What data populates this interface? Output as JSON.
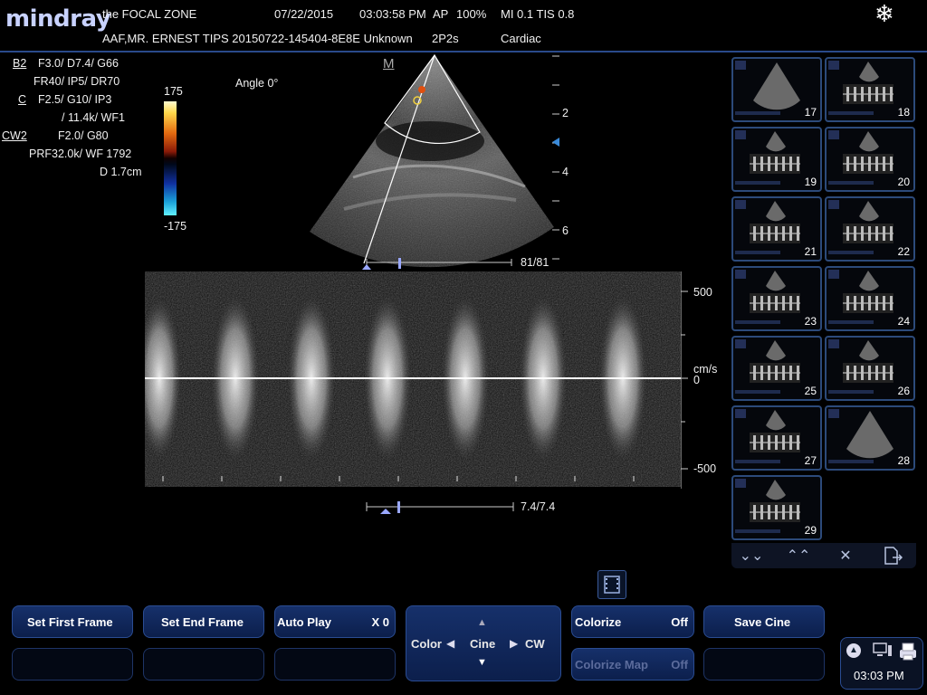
{
  "header": {
    "logo": "mindray",
    "zone": "the FOCAL ZONE",
    "date": "07/22/2015",
    "time": "03:03:58 PM",
    "ap_label": "AP",
    "ap_value": "100%",
    "mi_tis": "MI 0.1 TIS 0.8",
    "patient": "AAF,MR. ERNEST TIPS 20150722-145404-8E8E Unknown",
    "probe": "2P2s",
    "exam": "Cardiac",
    "freeze_icon": "snowflake-icon"
  },
  "params": {
    "b2_label": "B2",
    "b2_line1": "F3.0/ D7.4/ G66",
    "b2_line2": "FR40/ IP5/ DR70",
    "c_label": "C",
    "c_line1": "F2.5/ G10/ IP3",
    "c_line2": "/ 11.4k/ WF1",
    "cw_label": "CW2",
    "cw_line1": "F2.0/ G80",
    "cw_line2": "PRF32.0k/ WF 1792",
    "cw_line3": "D 1.7cm"
  },
  "colorbar": {
    "max": "175",
    "min": "-175"
  },
  "image": {
    "angle": "Angle 0°",
    "m_marker": "M",
    "depth_ticks": [
      "2",
      "4",
      "6"
    ],
    "frame_counter": "81/81",
    "cine_counter": "7.4/7.4"
  },
  "doppler": {
    "scale_top": "500",
    "scale_unit": "cm/s",
    "scale_zero": "0",
    "scale_bottom": "-500"
  },
  "thumbnails": [
    "17",
    "18",
    "19",
    "20",
    "21",
    "22",
    "23",
    "24",
    "25",
    "26",
    "27",
    "28",
    "29"
  ],
  "thumb_nav": {
    "down": "⌄⌄",
    "up": "⌃⌃",
    "close": "✕",
    "export": "export-icon"
  },
  "buttons": {
    "set_first": "Set First Frame",
    "set_end": "Set End Frame",
    "auto_play": "Auto Play",
    "auto_play_val": "X 0",
    "colorize": "Colorize",
    "colorize_val": "Off",
    "colorize_map": "Colorize Map",
    "colorize_map_val": "Off",
    "save_cine": "Save Cine"
  },
  "cine_ctrl": {
    "color": "Color",
    "cine": "Cine",
    "cw": "CW"
  },
  "clock": {
    "time": "03:03 PM"
  }
}
